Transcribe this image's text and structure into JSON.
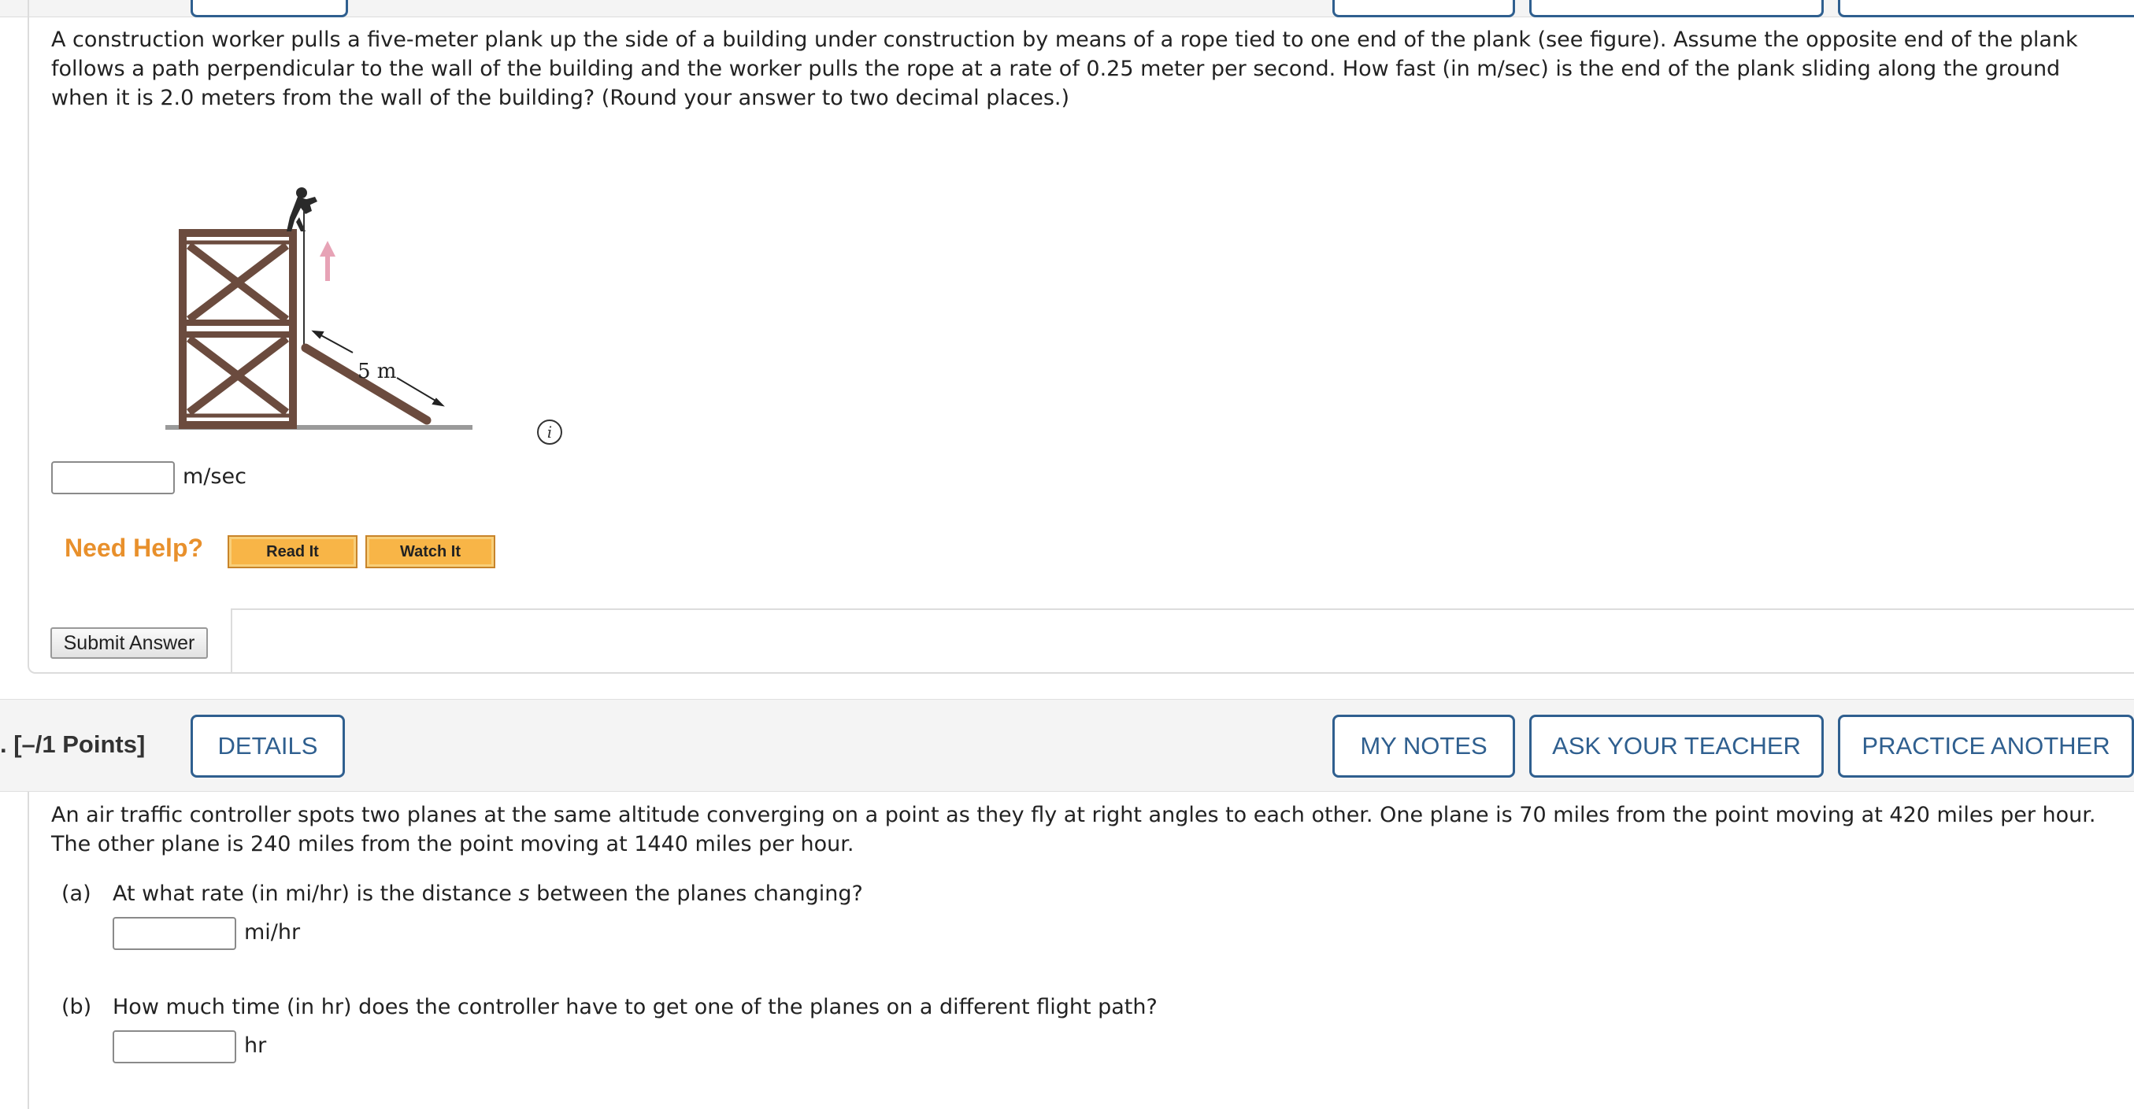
{
  "question1": {
    "text": "A construction worker pulls a five-meter plank up the side of a building under construction by means of a rope tied to one end of the plank (see figure). Assume the opposite end of the plank follows a path perpendicular to the wall of the building and the worker pulls the rope at a rate of 0.25 meter per second. How fast (in m/sec) is the end of the plank sliding along the ground when it is 2.0 meters from the wall of the building? (Round your answer to two decimal places.)",
    "figure_label": "5 m",
    "info_glyph": "i",
    "answer_value": "",
    "unit": "m/sec",
    "need_help_label": "Need Help?",
    "read_it_label": "Read It",
    "watch_it_label": "Watch It",
    "submit_label": "Submit Answer"
  },
  "question2_header": {
    "points_label": ". [–/1 Points]",
    "details_label": "DETAILS",
    "my_notes_label": "MY NOTES",
    "ask_teacher_label": "ASK YOUR TEACHER",
    "practice_label": "PRACTICE ANOTHER"
  },
  "question2": {
    "text": "An air traffic controller spots two planes at the same altitude converging on a point as they fly at right angles to each other. One plane is 70 miles from the point moving at 420 miles per hour. The other plane is 240 miles from the point moving at 1440 miles per hour.",
    "part_a": {
      "label": "(a)",
      "text_before": "At what rate (in mi/hr) is the distance ",
      "variable": "s",
      "text_after": " between the planes changing?",
      "unit": "mi/hr",
      "answer_value": ""
    },
    "part_b": {
      "label": "(b)",
      "text": "How much time (in hr) does the controller have to get one of the planes on a different flight path?",
      "unit": "hr",
      "answer_value": ""
    }
  },
  "colors": {
    "accent_blue": "#2f5f8f",
    "help_orange": "#e8902c",
    "help_button": "#f8b547"
  }
}
